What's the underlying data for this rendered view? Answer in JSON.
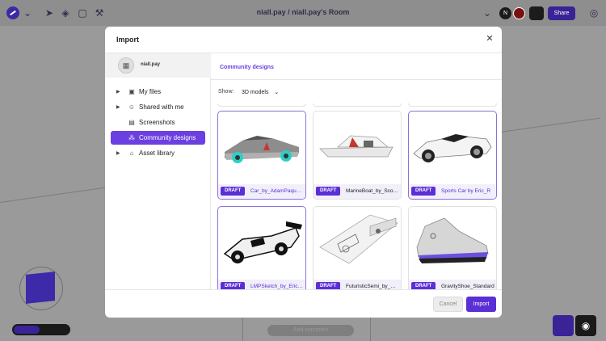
{
  "topbar": {
    "room_title": "niall.pay  /  niall.pay's Room",
    "avatar_initial": "N",
    "share_label": "Share"
  },
  "canvas": {
    "add_comment": "Add comment"
  },
  "modal": {
    "title": "Import",
    "user": {
      "name": "niall.pay"
    },
    "nav": [
      {
        "label": "My files",
        "icon": "folder-icon",
        "active": false
      },
      {
        "label": "Shared with me",
        "icon": "users-icon",
        "active": false
      },
      {
        "label": "Screenshots",
        "icon": "image-icon",
        "active": false
      },
      {
        "label": "Community designs",
        "icon": "community-icon",
        "active": true
      },
      {
        "label": "Asset library",
        "icon": "library-icon",
        "active": false
      }
    ],
    "breadcrumb": "Community designs",
    "filter": {
      "label": "Show:",
      "value": "3D models"
    },
    "items": [
      {
        "badge": "DRAFT",
        "name": "Car_by_AdamPaquette",
        "selected": true,
        "thumb": "race-car"
      },
      {
        "badge": "DRAFT",
        "name": "MarineBoat_by_ScottChen",
        "selected": false,
        "thumb": "boat"
      },
      {
        "badge": "DRAFT",
        "name": "Sports Car by Eric_R",
        "selected": true,
        "thumb": "sports-car"
      },
      {
        "badge": "DRAFT",
        "name": "LMPSketch_by_EricRoper",
        "selected": true,
        "thumb": "lmp-car"
      },
      {
        "badge": "DRAFT",
        "name": "FuturisticSemi_by_Devin",
        "selected": false,
        "thumb": "semi-truck"
      },
      {
        "badge": "DRAFT",
        "name": "GravityShoe_Standard",
        "selected": false,
        "thumb": "shoe"
      }
    ],
    "buttons": {
      "cancel": "Cancel",
      "import": "Import"
    }
  }
}
